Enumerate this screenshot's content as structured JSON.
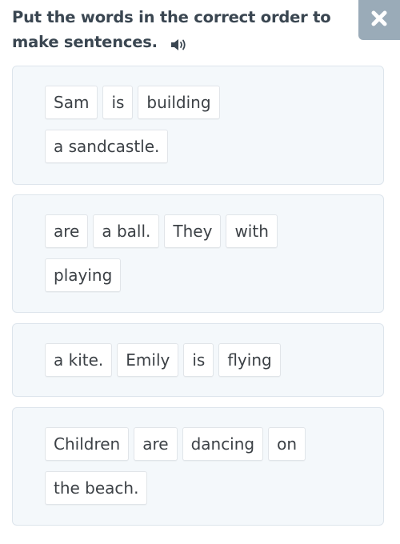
{
  "instruction": {
    "line1": "Put the words in the correct order to",
    "line2": "make sentences.",
    "audio_icon": "speaker-icon"
  },
  "close_button": {
    "icon": "close-icon",
    "color": "#9aabb8"
  },
  "colors": {
    "card_background": "#f4f8fb",
    "card_border": "#dde5ec",
    "tile_background": "#ffffff",
    "title_text": "#3a4651"
  },
  "sentences": [
    {
      "words": [
        "Sam",
        "is",
        "building",
        "a sandcastle."
      ]
    },
    {
      "words": [
        "are",
        "a ball.",
        "They",
        "with",
        "playing"
      ]
    },
    {
      "words": [
        "a kite.",
        "Emily",
        "is",
        "flying"
      ]
    },
    {
      "words": [
        "Children",
        "are",
        "dancing",
        "on",
        "the beach."
      ]
    }
  ]
}
